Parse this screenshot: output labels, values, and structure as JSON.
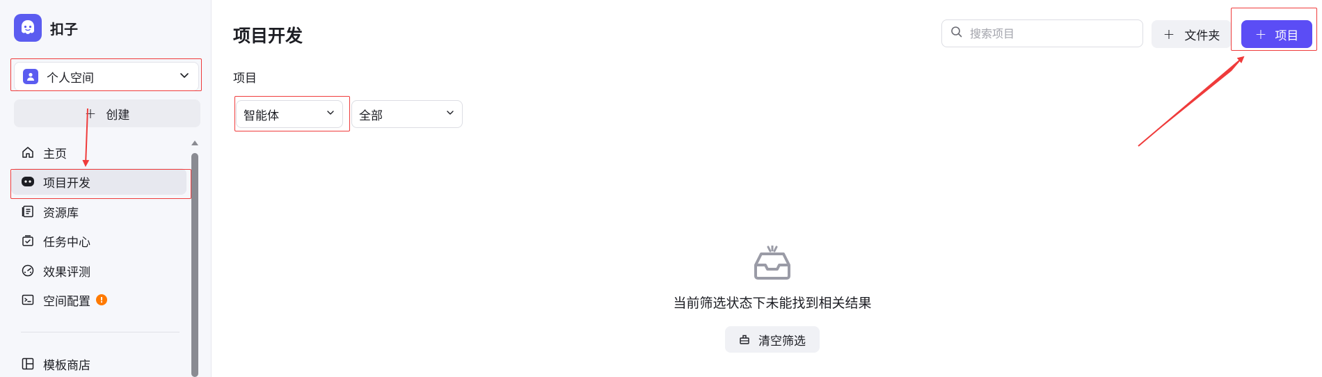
{
  "app": {
    "name": "扣子"
  },
  "sidebar": {
    "space_selector": {
      "label": "个人空间"
    },
    "create_label": "创建",
    "items": [
      {
        "label": "主页",
        "icon": "home-icon"
      },
      {
        "label": "项目开发",
        "icon": "bot-icon",
        "active": true
      },
      {
        "label": "资源库",
        "icon": "library-icon"
      },
      {
        "label": "任务中心",
        "icon": "task-icon"
      },
      {
        "label": "效果评测",
        "icon": "gauge-icon"
      },
      {
        "label": "空间配置",
        "icon": "terminal-icon",
        "badge": "!"
      },
      {
        "label": "模板商店",
        "icon": "layout-icon"
      }
    ]
  },
  "header": {
    "title": "项目开发",
    "search": {
      "placeholder": "搜索项目",
      "value": ""
    },
    "folder_button": "文件夹",
    "project_button": "项目"
  },
  "filters": {
    "section_label": "项目",
    "type_selected": "智能体",
    "scope_selected": "全部"
  },
  "empty_state": {
    "message": "当前筛选状态下未能找到相关结果",
    "clear_button": "清空筛选"
  },
  "colors": {
    "accent": "#5b4df5",
    "annotation": "#ef3b3b",
    "badge": "#ff7a00"
  }
}
